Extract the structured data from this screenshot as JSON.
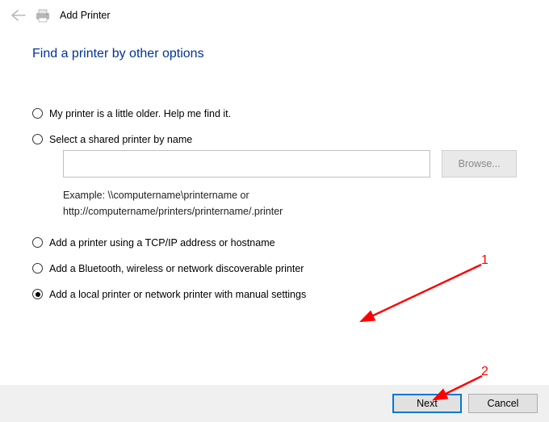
{
  "window": {
    "title": "Add Printer"
  },
  "page": {
    "heading": "Find a printer by other options"
  },
  "options": {
    "older": "My printer is a little older. Help me find it.",
    "shared": "Select a shared printer by name",
    "shared_input_value": "",
    "browse_label": "Browse...",
    "example_line1": "Example: \\\\computername\\printername or",
    "example_line2": "http://computername/printers/printername/.printer",
    "tcpip": "Add a printer using a TCP/IP address or hostname",
    "bluetooth": "Add a Bluetooth, wireless or network discoverable printer",
    "local": "Add a local printer or network printer with manual settings"
  },
  "footer": {
    "next": "Next",
    "cancel": "Cancel"
  },
  "annotations": {
    "num1": "1",
    "num2": "2"
  }
}
